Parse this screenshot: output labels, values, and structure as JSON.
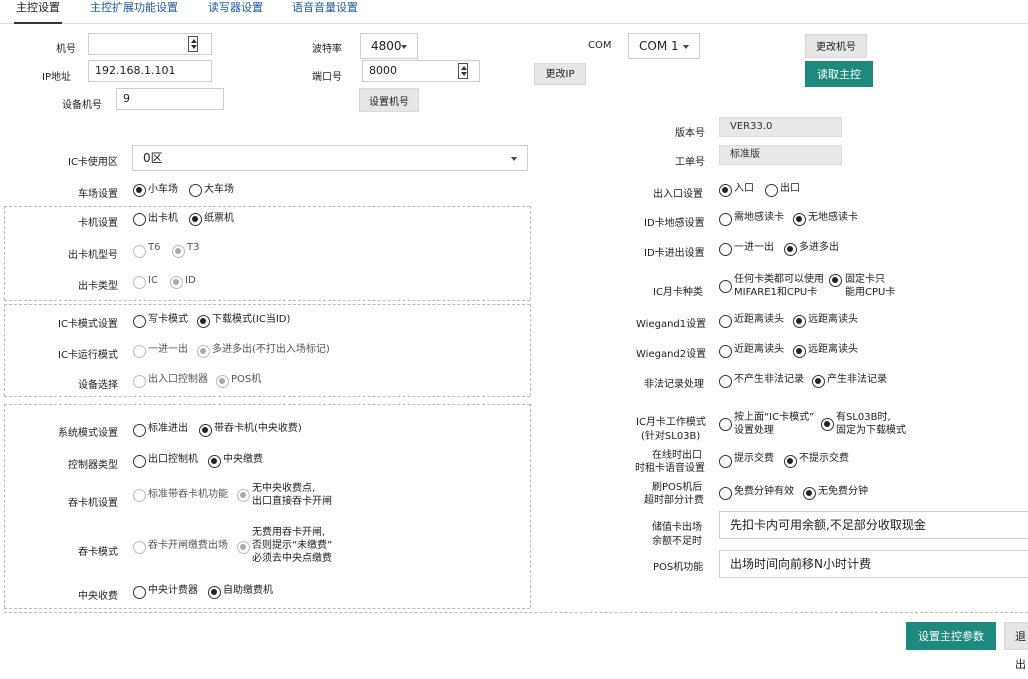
{
  "tabs": [
    "主控设置",
    "主控扩展功能设置",
    "读写器设置",
    "语音音量设置"
  ],
  "top": {
    "jihao_label": "机号",
    "jihao_value": "",
    "ip_label": "IP地址",
    "ip_value": "192.168.1.101",
    "device_no_label": "设备机号",
    "device_no_value": "9",
    "baud_label": "波特率",
    "baud_value": "4800",
    "port_label": "端口号",
    "port_value": "8000",
    "set_device_no_btn": "设置机号",
    "change_ip_btn": "更改IP",
    "com_label": "COM",
    "com_value": "COM 1",
    "change_no_btn": "更改机号",
    "read_master_btn": "读取主控"
  },
  "info": {
    "version_label": "版本号",
    "version_value": "VER33.0",
    "work_label": "工单号",
    "work_value": "标准版"
  },
  "ic_area": {
    "label": "IC卡使用区",
    "value": "0区"
  },
  "left": {
    "parking": {
      "label": "车场设置",
      "opt1": "小车场",
      "opt2": "大车场"
    },
    "card_machine": {
      "label": "卡机设置",
      "opt1": "出卡机",
      "opt2": "纸票机"
    },
    "out_model": {
      "label": "出卡机型号",
      "opt1": "T6",
      "opt2": "T3"
    },
    "out_type": {
      "label": "出卡类型",
      "opt1": "IC",
      "opt2": "ID"
    },
    "ic_mode": {
      "label": "IC卡模式设置",
      "opt1": "写卡模式",
      "opt2": "下载模式(IC当ID)"
    },
    "ic_run": {
      "label": "IC卡运行模式",
      "opt1": "一进一出",
      "opt2": "多进多出(不打出入场标记)"
    },
    "device_sel": {
      "label": "设备选择",
      "opt1": "出入口控制器",
      "opt2": "POS机"
    },
    "sys_mode": {
      "label": "系统模式设置",
      "opt1": "标准进出",
      "opt2": "带吞卡机(中央收费)"
    },
    "ctrl_type": {
      "label": "控制器类型",
      "opt1": "出口控制机",
      "opt2": "中央缴费"
    },
    "swallow_set": {
      "label": "吞卡机设置",
      "opt1": "标准带吞卡机功能",
      "opt2a": "无中央收费点,",
      "opt2b": "出口直接吞卡开闸"
    },
    "swallow_mode": {
      "label": "吞卡模式",
      "opt1": "吞卡开闸缴费出场",
      "opt2a": "无费用吞卡开闸,",
      "opt2b": "否则提示“未缴费”",
      "opt2c": "必须去中央点缴费"
    },
    "central": {
      "label": "中央收费",
      "opt1": "中央计费器",
      "opt2": "自助缴费机"
    }
  },
  "right": {
    "entrance": {
      "label": "出入口设置",
      "opt1": "入口",
      "opt2": "出口"
    },
    "id_sense": {
      "label": "ID卡地感设置",
      "opt1": "需地感读卡",
      "opt2": "无地感读卡"
    },
    "id_inout": {
      "label": "ID卡进出设置",
      "opt1": "一进一出",
      "opt2": "多进多出"
    },
    "ic_month": {
      "label": "IC月卡种类",
      "opt1a": "任何卡类都可以使用",
      "opt1b": "MIFARE1和CPU卡",
      "opt2a": "固定卡只",
      "opt2b": "能用CPU卡"
    },
    "wiegand1": {
      "label": "Wiegand1设置",
      "opt1": "近距离读头",
      "opt2": "远距离读头"
    },
    "wiegand2": {
      "label": "Wiegand2设置",
      "opt1": "近距离读头",
      "opt2": "远距离读头"
    },
    "illegal": {
      "label": "非法记录处理",
      "opt1": "不产生非法记录",
      "opt2": "产生非法记录"
    },
    "ic_work": {
      "label1": "IC月卡工作模式",
      "label2": "(针对SL03B)",
      "opt1a": "按上面“IC卡模式”",
      "opt1b": "设置处理",
      "opt2a": "有SL03B时,",
      "opt2b": "固定为下载模式"
    },
    "online_voice": {
      "label1": "在线时出口",
      "label2": "时租卡语音设置",
      "opt1": "提示交费",
      "opt2": "不提示交费"
    },
    "pos_billing": {
      "label1": "刷POS机后",
      "label2": "超时部分计费",
      "opt1": "免费分钟有效",
      "opt2": "无免费分钟"
    },
    "stored": {
      "label1": "储值卡出场",
      "label2": "余额不足时",
      "value": "先扣卡内可用余额,不足部分收取现金"
    },
    "pos_func": {
      "label": "POS机功能",
      "value": "出场时间向前移N小时计费"
    }
  },
  "footer": {
    "save_btn": "设置主控参数",
    "exit_btn": "退出"
  }
}
